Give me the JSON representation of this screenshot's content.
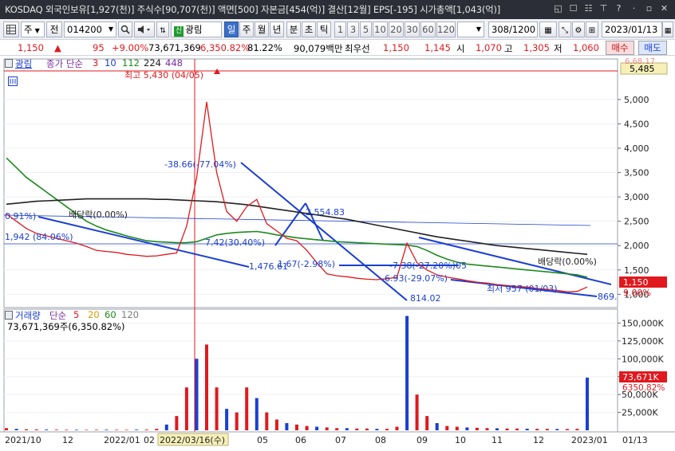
{
  "window": {
    "title": "KOSDAQ 외국인보유[1,927(천)]  주식수[90,707(천)]  액면[500]  자본금[454(억)]  결산[12월]  EPS[-195]  시가총액[1,043(억)]",
    "controls": [
      "◱",
      "☐",
      "☷",
      "⊤",
      "?",
      "·",
      "▫",
      "✕"
    ]
  },
  "toolbar": {
    "market": "주",
    "all_label": "전",
    "code": "014200",
    "stock_name": "광림",
    "name_badge": "신",
    "periods": [
      "일",
      "주",
      "월",
      "년",
      "분",
      "초",
      "틱"
    ],
    "active_period": "일",
    "intervals": [
      "1",
      "3",
      "5",
      "10",
      "20",
      "30",
      "60",
      "120"
    ],
    "page": "308/1200",
    "date": "2023/01/13"
  },
  "quote": {
    "price": "1,150",
    "arrow": "▲",
    "change": "95",
    "change_pct": "+9.00%",
    "volume": "73,671,369",
    "volume_pct": "6,350.82%",
    "ratio": "81.22%",
    "amount": "90,079백만",
    "best_label": "최우선",
    "bid": "1,150",
    "ask": "1,145",
    "open_label": "시",
    "open": "1,070",
    "high_label": "고",
    "high": "1,305",
    "low_label": "저",
    "low": "1,060",
    "buy_label": "매수",
    "sell_label": "매도"
  },
  "price_panel": {
    "name": "광림",
    "ma_label": "종가 단순",
    "ma_periods": [
      "3",
      "10",
      "112",
      "224",
      "448"
    ],
    "ma_colors": [
      "#e0191e",
      "#1b3fd1",
      "#1d8a1d",
      "#222222",
      "#7a2ca0"
    ],
    "top_badge": "5,485",
    "top_badge_faded": "6,68.17",
    "last_price_badge": "1,150",
    "last_change_badge": "9.00%",
    "annotations": {
      "max": "최고 5,430 (04/05)",
      "min": "최저 957 (01/03)",
      "div1": "배당락(0.00%)",
      "div2": "배당락(0.00%)",
      "a1": "-38.66(-77.04%)",
      "a2": "7.42(30.40%)",
      "a3": "1.67(-2.98%)",
      "a4": "-7.38(-27.20%)05",
      "a5": "-6.93(-29.07%)",
      "lvl1": "0.91%)",
      "lvl2": "1,942 (84.06%)",
      "lvl3": "1,476.61",
      "lvl4": "2,554.83",
      "lvl5": "814.02",
      "lvl6": "869."
    }
  },
  "volume_panel": {
    "label": "거래량",
    "ma_label": "단순",
    "ma_periods": [
      "5",
      "20",
      "60",
      "120"
    ],
    "ma_colors": [
      "#e0191e",
      "#d0a000",
      "#1d8a1d",
      "#7a7a7a"
    ],
    "value_text": "73,671,369주(6,350.82%)",
    "badge_value": "73,671K",
    "badge_pct": "6350.82%"
  },
  "x_axis": {
    "labels": [
      "2021/10",
      "12",
      "2022/01",
      "02",
      "2022/03/16(수)",
      "05",
      "06",
      "07",
      "08",
      "09",
      "10",
      "11",
      "12",
      "2023/01",
      "01/13"
    ],
    "highlight": "2022/03/16(수)"
  },
  "chart_data": {
    "type": "line",
    "price_axis": {
      "ticks": [
        5000,
        4500,
        4000,
        3500,
        3000,
        2500,
        2000,
        1500,
        1000
      ],
      "labels": [
        "5,000",
        "4,500",
        "4,000",
        "3,500",
        "3,000",
        "2,500",
        "2,000",
        "1,500",
        "1,000"
      ],
      "ylim": [
        760,
        5800
      ]
    },
    "volume_axis": {
      "ticks": [
        150000,
        125000,
        100000,
        75000,
        50000,
        25000
      ],
      "labels": [
        "150,000K",
        "125,000K",
        "100,000K",
        "75,000K",
        "50,000K",
        "25,000K"
      ],
      "ylim": [
        0,
        165000
      ]
    },
    "series": [
      {
        "name": "종가",
        "values": [
          2650,
          2500,
          2350,
          2250,
          2200,
          2150,
          2100,
          2050,
          1980,
          1900,
          1880,
          1860,
          1820,
          1800,
          1780,
          1790,
          1820,
          1850,
          2400,
          3400,
          4950,
          3500,
          2700,
          2500,
          2800,
          2950,
          2450,
          2300,
          2150,
          2100,
          1900,
          1650,
          1420,
          1380,
          1360,
          1330,
          1310,
          1300,
          1320,
          1350,
          2050,
          1650,
          1500,
          1400,
          1350,
          1320,
          1280,
          1250,
          1230,
          1200,
          1180,
          1160,
          1150,
          1120,
          1100,
          1080,
          1050,
          1060,
          1150
        ]
      },
      {
        "name": "112",
        "values": [
          3800,
          3600,
          3400,
          3250,
          3100,
          2950,
          2800,
          2650,
          2500,
          2400,
          2320,
          2260,
          2200,
          2150,
          2100,
          2080,
          2070,
          2060,
          2060,
          2080,
          2150,
          2220,
          2250,
          2270,
          2280,
          2290,
          2260,
          2220,
          2190,
          2160,
          2140,
          2120,
          2100,
          2080,
          2070,
          2060,
          2050,
          2040,
          2030,
          2020,
          2010,
          1980,
          1900,
          1800,
          1720,
          1660,
          1620,
          1600,
          1580,
          1560,
          1540,
          1520,
          1500,
          1480,
          1460,
          1440,
          1420,
          1400,
          1350
        ]
      },
      {
        "name": "224",
        "values": [
          2850,
          2870,
          2890,
          2910,
          2920,
          2930,
          2940,
          2950,
          2960,
          2960,
          2960,
          2960,
          2960,
          2960,
          2960,
          2950,
          2950,
          2940,
          2930,
          2920,
          2910,
          2900,
          2880,
          2860,
          2840,
          2810,
          2780,
          2750,
          2720,
          2690,
          2660,
          2630,
          2600,
          2570,
          2540,
          2500,
          2460,
          2420,
          2380,
          2340,
          2300,
          2260,
          2220,
          2180,
          2150,
          2120,
          2090,
          2060,
          2030,
          2000,
          1980,
          1960,
          1940,
          1920,
          1900,
          1880,
          1860,
          1840,
          1820
        ]
      }
    ],
    "volume_values": [
      3000,
      2000,
      1500,
      1200,
      1000,
      900,
      800,
      800,
      700,
      800,
      900,
      800,
      700,
      900,
      1000,
      2000,
      8000,
      20000,
      60000,
      100000,
      120000,
      60000,
      30000,
      25000,
      60000,
      45000,
      25000,
      15000,
      10000,
      8000,
      6000,
      5000,
      4000,
      3000,
      3000,
      2500,
      2500,
      2000,
      2000,
      5000,
      160000,
      50000,
      20000,
      10000,
      6000,
      5000,
      4000,
      3500,
      3000,
      2800,
      2500,
      2500,
      2200,
      2000,
      2000,
      1800,
      1800,
      2000,
      73671
    ]
  }
}
